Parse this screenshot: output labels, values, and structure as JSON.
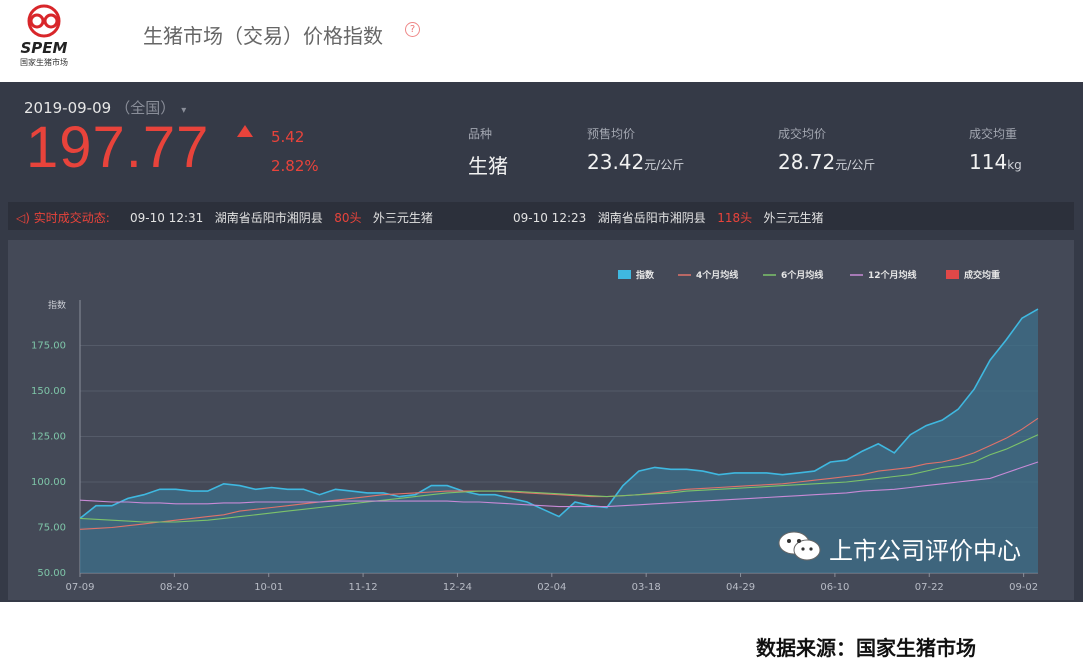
{
  "header": {
    "logo_text": "SPEM",
    "logo_sub": "国家生猪市场",
    "title": "生猪市场（交易）价格指数",
    "help": "?"
  },
  "summary": {
    "date": "2019-09-09",
    "scope": "（全国）",
    "value": "197.77",
    "change_abs": "5.42",
    "change_pct": "2.82%",
    "stats": [
      {
        "label": "品种",
        "value": "生猪",
        "unit": ""
      },
      {
        "label": "预售均价",
        "value": "23.42",
        "unit": "元/公斤"
      },
      {
        "label": "成交均价",
        "value": "28.72",
        "unit": "元/公斤"
      },
      {
        "label": "成交均重",
        "value": "114",
        "unit": "kg"
      }
    ]
  },
  "ticker": {
    "label": "实时成交动态:",
    "items": [
      {
        "time": "09-10 12:31",
        "place": "湖南省岳阳市湘阴县",
        "heads": "80头",
        "breed": "外三元生猪"
      },
      {
        "time": "09-10 12:23",
        "place": "湖南省岳阳市湘阴县",
        "heads": "118头",
        "breed": "外三元生猪"
      }
    ]
  },
  "colors": {
    "index": "#3fb8e0",
    "ma4": "#e0726a",
    "ma6": "#7cc26a",
    "ma12": "#c88ad6",
    "weight": "#e04848"
  },
  "chart_data": {
    "type": "area",
    "ylabel": "指数",
    "ylim": [
      50,
      200
    ],
    "yticks": [
      "50.00",
      "75.00",
      "100.00",
      "125.00",
      "150.00",
      "175.00"
    ],
    "xtick_labels": [
      "07-09",
      "08-20",
      "10-01",
      "11-12",
      "12-24",
      "02-04",
      "03-18",
      "04-29",
      "06-10",
      "07-22",
      "09-02"
    ],
    "legend": [
      "指数",
      "4个月均线",
      "6个月均线",
      "12个月均线",
      "成交均重"
    ],
    "legend_position": "top-right",
    "series": [
      {
        "name": "指数",
        "values": [
          80,
          87,
          87,
          91,
          93,
          96,
          96,
          95,
          95,
          99,
          98,
          96,
          97,
          96,
          96,
          93,
          96,
          95,
          94,
          94,
          92,
          93,
          98,
          98,
          95,
          93,
          93,
          91,
          89,
          85,
          81,
          89,
          87,
          86,
          98,
          106,
          108,
          107,
          107,
          106,
          104,
          105,
          105,
          105,
          104,
          105,
          106,
          111,
          112,
          117,
          121,
          116,
          126,
          131,
          134,
          140,
          151,
          167,
          178,
          190,
          195
        ]
      },
      {
        "name": "4个月均线",
        "values": [
          74,
          74.5,
          75,
          76,
          77,
          78,
          79,
          80,
          81,
          82,
          84,
          85,
          86,
          87,
          88,
          89,
          90,
          91,
          92,
          93,
          93.5,
          94,
          94.5,
          95,
          95,
          95,
          95,
          94.5,
          94,
          93.5,
          93,
          92.5,
          92,
          92,
          92.5,
          93,
          94,
          95,
          96,
          96.5,
          97,
          97.5,
          98,
          98.5,
          99,
          100,
          101,
          102,
          103,
          104,
          106,
          107,
          108,
          110,
          111,
          113,
          116,
          120,
          124,
          129,
          135
        ]
      },
      {
        "name": "6个月均线",
        "values": [
          80,
          79.5,
          79,
          78.5,
          78,
          78,
          78,
          78.5,
          79,
          80,
          81,
          82,
          83,
          84,
          85,
          86,
          87,
          88,
          89,
          90,
          91,
          92,
          93,
          94,
          94.5,
          95,
          95,
          95,
          94.5,
          94,
          93.5,
          93,
          92.5,
          92,
          92.5,
          93,
          93.5,
          94,
          95,
          95.5,
          96,
          96.5,
          97,
          97.5,
          98,
          98.5,
          99,
          99.5,
          100,
          101,
          102,
          103,
          104,
          106,
          108,
          109,
          111,
          115,
          118,
          122,
          126
        ]
      },
      {
        "name": "12个月均线",
        "values": [
          90,
          89.5,
          89,
          89,
          88.5,
          88.5,
          88,
          88,
          88,
          88.5,
          88.5,
          89,
          89,
          89,
          89,
          89,
          89.5,
          89.5,
          89.5,
          89.5,
          89.5,
          89.5,
          89.5,
          89.5,
          89,
          89,
          88.5,
          88,
          87.5,
          87,
          86.5,
          86.5,
          86.5,
          86.5,
          87,
          87.5,
          88,
          88.5,
          89,
          89.5,
          90,
          90.5,
          91,
          91.5,
          92,
          92.5,
          93,
          93.5,
          94,
          95,
          95.5,
          96,
          97,
          98,
          99,
          100,
          101,
          102,
          105,
          108,
          111
        ]
      }
    ]
  },
  "watermark": {
    "text": "上市公司评价中心"
  },
  "footer": {
    "source": "数据来源：国家生猪市场"
  }
}
